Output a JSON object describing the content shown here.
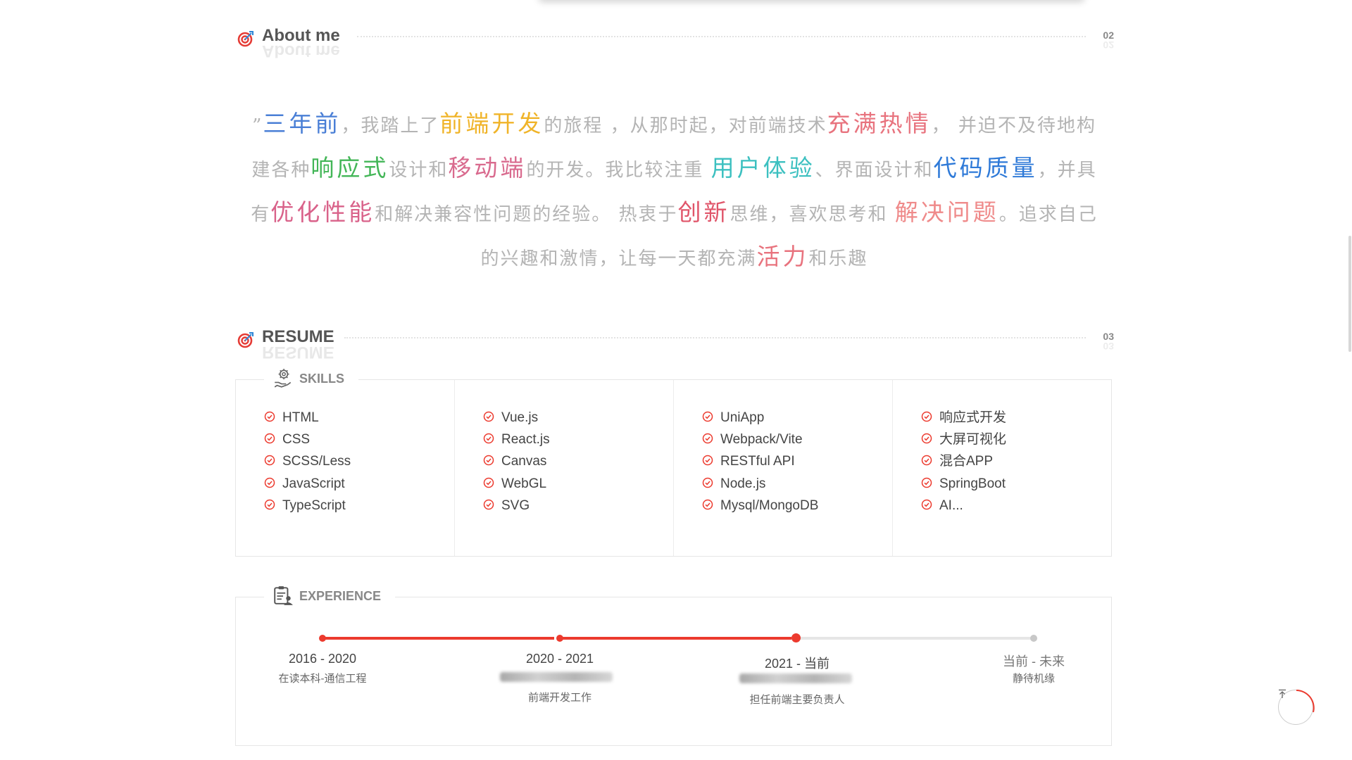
{
  "about_section": {
    "title": "About me",
    "number": "02",
    "paragraph": [
      {
        "t": "”",
        "c": null
      },
      {
        "t": "三年前",
        "c": "#4a7fd6",
        "hl": true
      },
      {
        "t": "，我踏上了",
        "c": null
      },
      {
        "t": "前端开发",
        "c": "#f0b429",
        "hl": true
      },
      {
        "t": "的旅程 ，从那时起，对前端技术",
        "c": null
      },
      {
        "t": "充满热情",
        "c": "#e8737e",
        "hl": true
      },
      {
        "t": "， 并迫不及待地构建各种",
        "c": null
      },
      {
        "t": "响应式",
        "c": "#43b657",
        "hl": true
      },
      {
        "t": "设计和",
        "c": null
      },
      {
        "t": "移动端",
        "c": "#d96a8e",
        "hl": true
      },
      {
        "t": "的开发。我比较注重 ",
        "c": null
      },
      {
        "t": "用户体验",
        "c": "#3cc0c0",
        "hl": true
      },
      {
        "t": "、界面设计和",
        "c": null
      },
      {
        "t": "代码质量",
        "c": "#2f7ad8",
        "hl": true
      },
      {
        "t": "，并具有",
        "c": null
      },
      {
        "t": "优化性能",
        "c": "#d9628a",
        "hl": true
      },
      {
        "t": "和解决兼容性问题的经验。 热衷于",
        "c": null
      },
      {
        "t": "创新",
        "c": "#e0556a",
        "hl": true
      },
      {
        "t": "思维，喜欢思考和 ",
        "c": null
      },
      {
        "t": "解决问题",
        "c": "#ef8a8a",
        "hl": true
      },
      {
        "t": "。追求自己的兴趣和激情，让每一天都充满",
        "c": null
      },
      {
        "t": "活力",
        "c": "#e8737e",
        "hl": true
      },
      {
        "t": "和乐趣",
        "c": null
      }
    ]
  },
  "resume_section": {
    "title": "RESUME",
    "number": "03",
    "skills": {
      "label": "SKILLS",
      "columns": [
        [
          "HTML",
          "CSS",
          "SCSS/Less",
          "JavaScript",
          "TypeScript"
        ],
        [
          "Vue.js",
          "React.js",
          "Canvas",
          "WebGL",
          "SVG"
        ],
        [
          "UniApp",
          "Webpack/Vite",
          "RESTful API",
          "Node.js",
          "Mysql/MongoDB"
        ],
        [
          "响应式开发",
          "大屏可视化",
          "混合APP",
          "SpringBoot",
          "AI..."
        ]
      ]
    },
    "experience": {
      "label": "EXPERIENCE",
      "items": [
        {
          "period": "2016 - 2020",
          "desc": "在读本科-通信工程",
          "desc2": "",
          "active": true
        },
        {
          "period": "2020 - 2021",
          "desc": "",
          "desc2": "前端开发工作",
          "active": true
        },
        {
          "period": "2021 - 当前",
          "desc": "",
          "desc2": "担任前端主要负责人",
          "active": true
        },
        {
          "period": "当前 - 未来",
          "desc": "静待机缘",
          "desc2": "",
          "active": false
        }
      ]
    }
  },
  "back_to_top_icon": "arrow-up-to-line-icon",
  "colors": {
    "accent": "#ec3a2e",
    "muted_text": "#b4b4b4",
    "timeline_inactive": "#e6e6e6"
  }
}
